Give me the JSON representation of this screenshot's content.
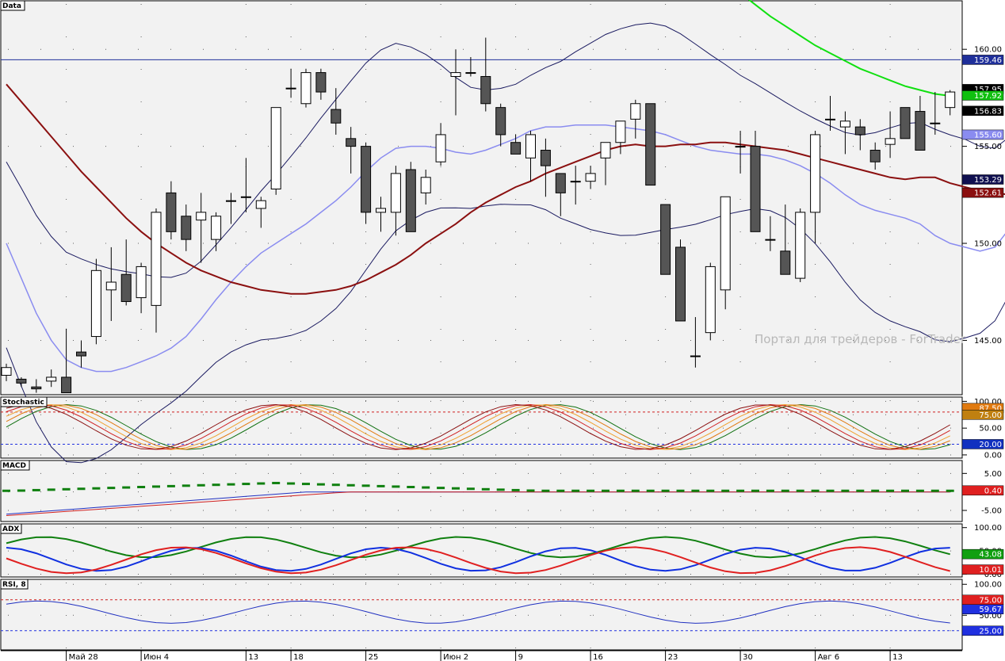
{
  "chart_data": [
    {
      "panel": "Data",
      "type": "candlestick",
      "title": "Data",
      "yticks": [
        145.0,
        150.0,
        155.0,
        160.0
      ],
      "ylim": [
        142.2,
        162.5
      ],
      "watermark": "Портал для трейдеров - ForTrader",
      "price_badges": [
        {
          "text": "159.46",
          "value": 159.46,
          "color": "#1f2f9a"
        },
        {
          "text": "157.95",
          "value": 157.95,
          "color": "#000000"
        },
        {
          "text": "157.92",
          "value": 157.62,
          "color": "#10c010"
        },
        {
          "text": "156.83",
          "value": 156.83,
          "color": "#000000"
        },
        {
          "text": "155.60",
          "value": 155.6,
          "color": "#8a8cf0"
        },
        {
          "text": "153.29",
          "value": 153.29,
          "color": "#101050"
        },
        {
          "text": "152.61",
          "value": 152.61,
          "color": "#8b1010"
        }
      ],
      "horizontal_line": {
        "value": 159.46,
        "color": "#1f2f9a"
      },
      "candles": [
        [
          143.2,
          143.8,
          142.9,
          143.6
        ],
        [
          143.0,
          143.1,
          142.6,
          142.8
        ],
        [
          142.6,
          143.0,
          142.3,
          142.5
        ],
        [
          142.9,
          143.5,
          142.6,
          143.1
        ],
        [
          143.1,
          145.6,
          142.5,
          142.3
        ],
        [
          144.4,
          145.0,
          143.6,
          144.2
        ],
        [
          145.2,
          149.2,
          144.8,
          148.6
        ],
        [
          147.6,
          149.8,
          146.0,
          148.0
        ],
        [
          148.4,
          150.2,
          146.8,
          147.0
        ],
        [
          147.2,
          149.0,
          146.4,
          148.8
        ],
        [
          146.8,
          151.8,
          145.4,
          151.6
        ],
        [
          152.6,
          153.2,
          150.2,
          150.6
        ],
        [
          151.4,
          152.0,
          149.6,
          150.2
        ],
        [
          151.2,
          152.6,
          149.0,
          151.6
        ],
        [
          150.2,
          151.6,
          149.6,
          151.4
        ],
        [
          152.2,
          152.6,
          151.0,
          152.2
        ],
        [
          152.4,
          154.4,
          151.6,
          152.4
        ],
        [
          151.8,
          152.4,
          150.8,
          152.2
        ],
        [
          152.8,
          157.0,
          152.5,
          157.0
        ],
        [
          158.0,
          159.0,
          157.5,
          158.0
        ],
        [
          157.2,
          159.0,
          157.0,
          158.8
        ],
        [
          158.8,
          159.0,
          157.4,
          157.8
        ],
        [
          156.9,
          158.0,
          155.6,
          156.2
        ],
        [
          155.4,
          156.0,
          153.6,
          155.0
        ],
        [
          155.0,
          155.2,
          151.0,
          151.6
        ],
        [
          151.6,
          152.4,
          150.6,
          151.8
        ],
        [
          151.6,
          154.0,
          150.4,
          153.6
        ],
        [
          153.8,
          154.2,
          150.6,
          150.6
        ],
        [
          152.6,
          153.8,
          152.0,
          153.4
        ],
        [
          154.2,
          156.2,
          154.0,
          155.6
        ],
        [
          158.6,
          160.0,
          156.6,
          158.8
        ],
        [
          158.8,
          159.6,
          158.6,
          158.8
        ],
        [
          158.6,
          160.6,
          156.8,
          157.2
        ],
        [
          157.0,
          157.2,
          155.0,
          155.6
        ],
        [
          155.2,
          155.6,
          154.6,
          154.6
        ],
        [
          154.4,
          155.8,
          153.2,
          155.6
        ],
        [
          154.8,
          155.4,
          152.4,
          154.0
        ],
        [
          153.6,
          153.6,
          151.4,
          152.6
        ],
        [
          153.2,
          154.0,
          152.0,
          153.2
        ],
        [
          153.2,
          154.0,
          152.8,
          153.6
        ],
        [
          154.4,
          155.2,
          153.0,
          155.2
        ],
        [
          155.2,
          156.2,
          154.6,
          156.3
        ],
        [
          156.4,
          157.4,
          155.4,
          157.2
        ],
        [
          157.2,
          157.2,
          153.0,
          153.0
        ],
        [
          152.0,
          152.0,
          148.4,
          148.4
        ],
        [
          149.8,
          150.2,
          146.0,
          146.0
        ],
        [
          144.2,
          146.2,
          143.6,
          144.2
        ],
        [
          145.4,
          149.0,
          145.0,
          148.8
        ],
        [
          147.6,
          152.4,
          146.6,
          152.4
        ],
        [
          155.0,
          155.8,
          153.6,
          155.0
        ],
        [
          155.0,
          155.8,
          151.8,
          150.6
        ],
        [
          150.2,
          151.4,
          149.6,
          150.2
        ],
        [
          149.6,
          152.0,
          148.4,
          148.4
        ],
        [
          148.2,
          151.8,
          148.0,
          151.6
        ],
        [
          151.6,
          155.8,
          150.0,
          155.6
        ],
        [
          156.4,
          157.6,
          155.8,
          156.4
        ],
        [
          156.0,
          156.8,
          154.6,
          156.3
        ],
        [
          156.0,
          156.4,
          154.8,
          155.6
        ],
        [
          154.8,
          155.2,
          153.8,
          154.2
        ],
        [
          155.1,
          156.8,
          154.4,
          155.4
        ],
        [
          157.0,
          157.0,
          155.4,
          155.4
        ],
        [
          156.8,
          157.6,
          154.8,
          154.8
        ],
        [
          156.2,
          157.8,
          155.6,
          156.2
        ],
        [
          157.0,
          157.9,
          156.6,
          157.8
        ]
      ],
      "ma_red": [
        158.2,
        157.3,
        156.4,
        155.5,
        154.6,
        153.7,
        152.9,
        152.1,
        151.3,
        150.6,
        150.0,
        149.5,
        149.0,
        148.6,
        148.3,
        148.0,
        147.8,
        147.6,
        147.5,
        147.4,
        147.4,
        147.5,
        147.6,
        147.8,
        148.1,
        148.5,
        148.9,
        149.4,
        150.0,
        150.5,
        151.0,
        151.6,
        152.1,
        152.5,
        152.9,
        153.2,
        153.6,
        153.9,
        154.2,
        154.5,
        154.8,
        155.0,
        155.1,
        155.0,
        155.0,
        155.1,
        155.1,
        155.2,
        155.2,
        155.1,
        155.0,
        154.9,
        154.8,
        154.6,
        154.4,
        154.2,
        154.0,
        153.8,
        153.6,
        153.4,
        153.3,
        153.4,
        153.4,
        153.1,
        152.9,
        152.7,
        152.6,
        152.5,
        152.5,
        152.5,
        152.5,
        152.5,
        152.5,
        152.6,
        152.6,
        152.6,
        152.7,
        152.7,
        152.8,
        152.9,
        153.0,
        153.1,
        153.2,
        153.3
      ],
      "bb_mid": [
        150.0,
        148.2,
        146.4,
        145.0,
        144.0,
        143.6,
        143.4,
        143.4,
        143.6,
        143.9,
        144.2,
        144.6,
        145.2,
        146.1,
        147.1,
        148.0,
        148.8,
        149.5,
        150.0,
        150.5,
        151.0,
        151.6,
        152.2,
        152.9,
        153.7,
        154.4,
        154.9,
        155.0,
        155.0,
        154.9,
        154.7,
        154.6,
        154.8,
        155.1,
        155.4,
        155.8,
        156.0,
        156.0,
        156.1,
        156.1,
        156.1,
        156.0,
        155.9,
        155.8,
        155.6,
        155.3,
        155.0,
        154.8,
        154.7,
        154.6,
        154.6,
        154.5,
        154.3,
        154.0,
        153.6,
        153.1,
        152.5,
        152.0,
        151.7,
        151.5,
        151.3,
        151.0,
        150.4,
        150.0,
        149.8,
        149.6,
        149.8,
        150.8,
        151.8,
        152.3,
        152.6,
        152.8,
        153.0,
        153.1,
        153.3,
        153.5,
        153.9,
        154.4,
        155.0,
        155.6
      ]
    },
    {
      "panel": "Stochastic",
      "type": "line",
      "title": "Stochastic",
      "yticks": [
        0.0,
        20.0,
        50.0,
        75.0,
        100.0
      ],
      "ylim": [
        -6,
        108
      ],
      "levels": [
        20,
        80
      ],
      "badges": [
        {
          "text": "87.50",
          "value": 87.5,
          "color": "#e07a10"
        },
        {
          "text": "75.00",
          "value": 75.0,
          "color": "#c08010"
        },
        {
          "text": "20.00",
          "value": 20.0,
          "color": "#1030c0"
        }
      ]
    },
    {
      "panel": "MACD",
      "type": "line",
      "title": "MACD",
      "yticks": [
        -5.0,
        0.0,
        5.0
      ],
      "ylim": [
        -8,
        8.5
      ],
      "badges": [
        {
          "text": "0.40",
          "value": 0.4,
          "color": "#e02020"
        }
      ]
    },
    {
      "panel": "ADX",
      "type": "line",
      "title": "ADX",
      "yticks": [
        0.0,
        50.0,
        100.0
      ],
      "ylim": [
        -6,
        108
      ],
      "badges": [
        {
          "text": "43.08",
          "value": 43.08,
          "color": "#10a010"
        },
        {
          "text": "10.01",
          "value": 10.01,
          "color": "#e02020"
        }
      ]
    },
    {
      "panel": "RSI",
      "type": "line",
      "title": "RSI, 8",
      "yticks": [
        25.0,
        50.0,
        75.0,
        100.0
      ],
      "ylim": [
        -6,
        108
      ],
      "levels": [
        25,
        75
      ],
      "badges": [
        {
          "text": "75.00",
          "value": 75.0,
          "color": "#e02020"
        },
        {
          "text": "59.67",
          "value": 59.67,
          "color": "#2030e0"
        },
        {
          "text": "25.00",
          "value": 25.0,
          "color": "#2030e0"
        }
      ]
    }
  ],
  "x_axis": {
    "labels": [
      {
        "text": "Май 28",
        "bar": 4
      },
      {
        "text": "Июн 4",
        "bar": 9
      },
      {
        "text": "13",
        "bar": 16
      },
      {
        "text": "18",
        "bar": 19
      },
      {
        "text": "25",
        "bar": 24
      },
      {
        "text": "Июн 2",
        "bar": 29
      },
      {
        "text": "9",
        "bar": 34
      },
      {
        "text": "16",
        "bar": 39
      },
      {
        "text": "23",
        "bar": 44
      },
      {
        "text": "30",
        "bar": 49
      },
      {
        "text": "Авг 6",
        "bar": 54
      },
      {
        "text": "13",
        "bar": 59
      }
    ]
  }
}
